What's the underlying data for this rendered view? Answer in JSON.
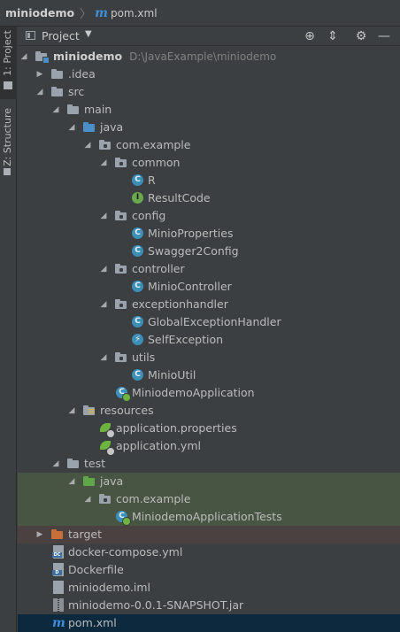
{
  "breadcrumb": {
    "project": "miniodemo",
    "file": "pom.xml"
  },
  "sidebar": {
    "project_tab": "1: Project",
    "structure_tab": "Z: Structure"
  },
  "panel": {
    "view": "Project"
  },
  "tree": {
    "root_name": "miniodemo",
    "root_path": "D:\\JavaExample\\miniodemo",
    "idea": ".idea",
    "src": "src",
    "main": "main",
    "java": "java",
    "com_example": "com.example",
    "common": "common",
    "r": "R",
    "result_code": "ResultCode",
    "config": "config",
    "minio_properties": "MinioProperties",
    "swagger2_config": "Swagger2Config",
    "controller": "controller",
    "minio_controller": "MinioController",
    "exceptionhandler": "exceptionhandler",
    "global_exception_handler": "GlobalExceptionHandler",
    "self_exception": "SelfException",
    "utils": "utils",
    "minio_util": "MinioUtil",
    "miniodemo_application": "MiniodemoApplication",
    "resources": "resources",
    "application_properties": "application.properties",
    "application_yml": "application.yml",
    "test": "test",
    "test_java": "java",
    "test_com_example": "com.example",
    "miniodemo_application_tests": "MiniodemoApplicationTests",
    "target": "target",
    "docker_compose": "docker-compose.yml",
    "dockerfile": "Dockerfile",
    "miniodemo_iml": "miniodemo.iml",
    "jar": "miniodemo-0.0.1-SNAPSHOT.jar",
    "pom": "pom.xml"
  }
}
